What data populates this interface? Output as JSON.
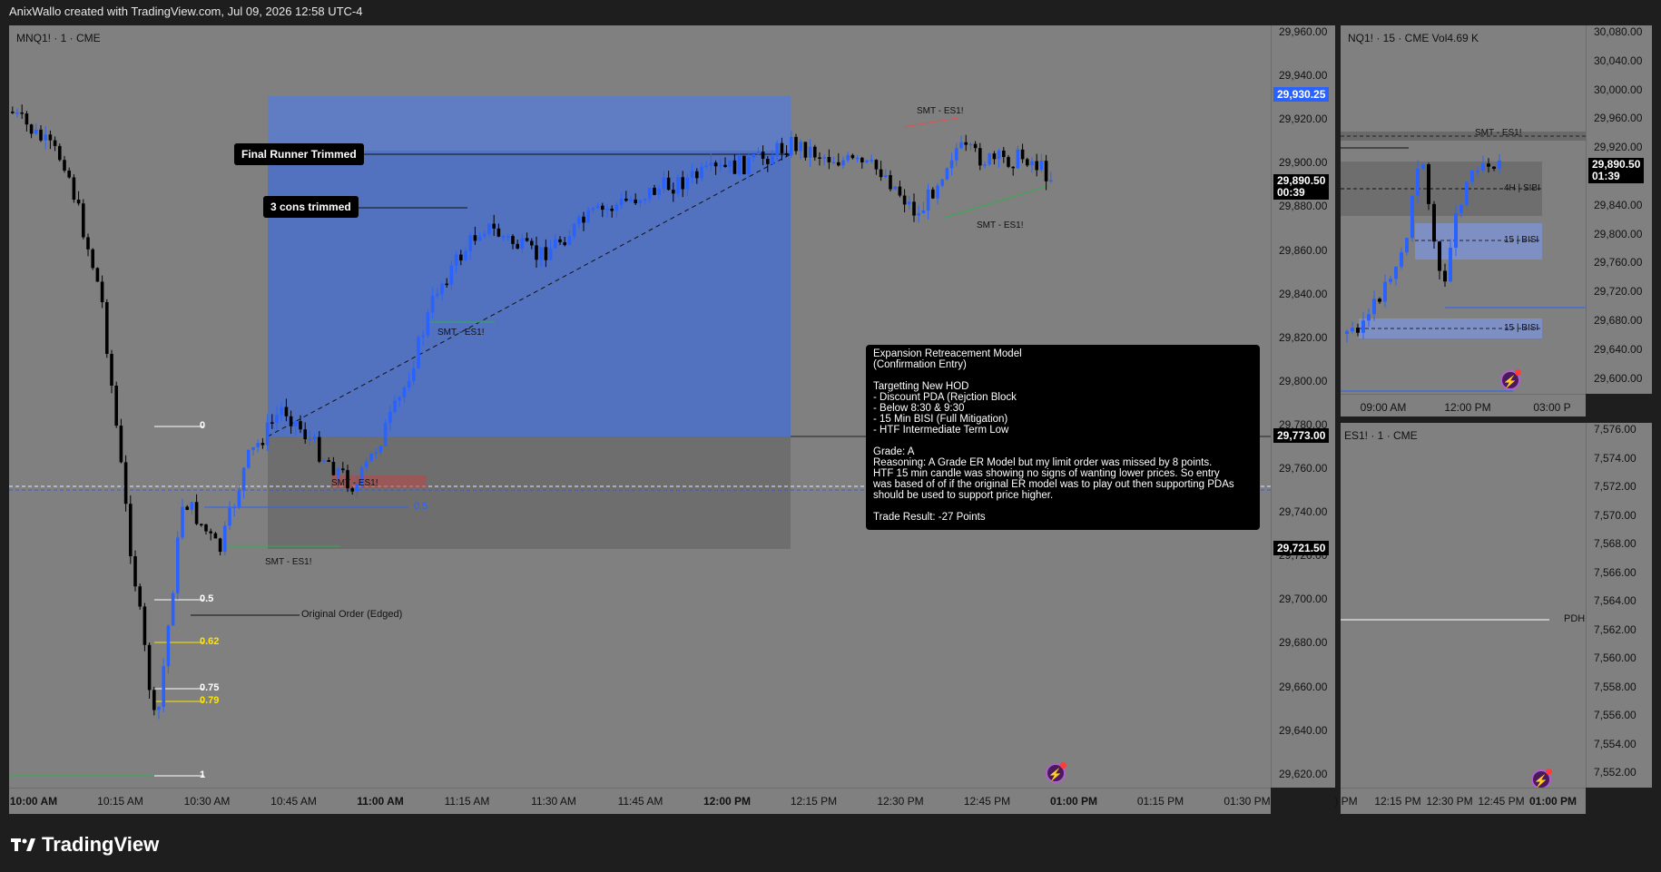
{
  "header": {
    "attribution": "AnixWallo created with TradingView.com, Jul 09, 2026 12:58 UTC-4"
  },
  "brand": {
    "name": "TradingView"
  },
  "main_chart": {
    "symbol_label": "MNQ1! · 1 · CME",
    "price_ticks": [
      "29,960.00",
      "29,940.00",
      "29,920.00",
      "29,900.00",
      "29,880.00",
      "29,860.00",
      "29,840.00",
      "29,820.00",
      "29,800.00",
      "29,780.00",
      "29,760.00",
      "29,740.00",
      "29,720.00",
      "29,700.00",
      "29,680.00",
      "29,660.00",
      "29,640.00",
      "29,620.00"
    ],
    "time_ticks": [
      "10:00 AM",
      "10:15 AM",
      "10:30 AM",
      "10:45 AM",
      "11:00 AM",
      "11:15 AM",
      "11:30 AM",
      "11:45 AM",
      "12:00 PM",
      "12:15 PM",
      "12:30 PM",
      "12:45 PM",
      "01:00 PM",
      "01:15 PM",
      "01:30 PM"
    ],
    "price_tags": {
      "target": "29,930.25",
      "last": "29,890.50",
      "countdown": "00:39",
      "entry": "29,773.00",
      "stop": "29,721.50"
    },
    "notes": {
      "final_runner": "Final Runner Trimmed",
      "three_cons": "3 cons trimmed"
    },
    "annotations": {
      "smt_1": "SMT - ES1!",
      "smt_2": "SMT - ES1!",
      "smt_3": "SMT - ES1!",
      "smt_4": "SMT - ES1!",
      "smt_5": "SMT - ES1!",
      "original_order": "Original Order (Edged)",
      "fib_mid": "0.5"
    },
    "fib_levels": [
      "0",
      "0.5",
      "0.62",
      "0.75",
      "0.79",
      "1"
    ],
    "colors": {
      "target_zone": "#4a6fc9",
      "stop_zone": "#6b6b6b",
      "bull": "#2962ff",
      "bear": "#000000",
      "price_tag_blue": "#2962ff"
    }
  },
  "info_box": {
    "lines": [
      "Expansion Retreacement Model",
      "(Confirmation Entry)",
      "",
      "Targetting New HOD",
      "- Discount PDA (Rejction Block",
      "- Below 8:30 & 9:30",
      "- 15 Min BISI (Full Mitigation)",
      "- HTF Intermediate Term Low",
      "",
      "Grade: A",
      "Reasoning: A Grade ER Model but my limit order was missed by 8 points.",
      "HTF 15 min candle was showing no signs of wanting lower prices. So  entry",
      "was based of of if the original ER model was to play out then supporting PDAs",
      "should be used to support price higher.",
      "",
      "Trade Result: -27 Points"
    ]
  },
  "nq_chart": {
    "symbol_label": "NQ1! · 15 · CME  Vol4.69 K",
    "price_ticks": [
      "30,080.00",
      "30,040.00",
      "30,000.00",
      "29,960.00",
      "29,920.00",
      "29,880.00",
      "29,840.00",
      "29,800.00",
      "29,760.00",
      "29,720.00",
      "29,680.00",
      "29,640.00",
      "29,600.00"
    ],
    "time_ticks": [
      "09:00 AM",
      "12:00 PM",
      "03:00 P"
    ],
    "last_price": "29,890.50",
    "countdown": "01:39",
    "labels": {
      "smt": "SMT - ES1!",
      "sibi": "4H | SIBI",
      "bisi_1": "15 | BISI",
      "bisi_2": "15 | BISI"
    }
  },
  "es_chart": {
    "symbol_label": "ES1! · 1 · CME",
    "price_ticks": [
      "7,576.00",
      "7,574.00",
      "7,572.00",
      "7,570.00",
      "7,568.00",
      "7,566.00",
      "7,564.00",
      "7,562.00",
      "7,560.00",
      "7,558.00",
      "7,556.00",
      "7,554.00",
      "7,552.00"
    ],
    "time_ticks": [
      ") PM",
      "12:15 PM",
      "12:30 PM",
      "12:45 PM",
      "01:00 PM"
    ],
    "labels": {
      "pdh": "PDH"
    }
  }
}
